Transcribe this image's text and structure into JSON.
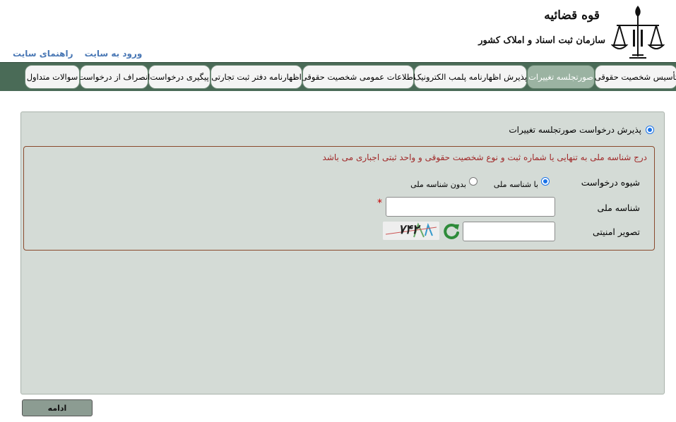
{
  "header": {
    "links": [
      "ورود به سایت",
      "راهنمای سایت"
    ],
    "logo_line1": "قوه قضائیه",
    "logo_line2": "سازمان ثبت اسناد و املاک کشور"
  },
  "nav": {
    "tabs": [
      {
        "label": "تأسیس شخصیت حقوقی",
        "active": false
      },
      {
        "label": "صورتجلسه تغییرات",
        "active": true
      },
      {
        "label": "پذیرش اظهارنامه پلمب الکترونیک",
        "active": false
      },
      {
        "label": "اطلاعات عمومی شخصیت حقوقی",
        "active": false
      },
      {
        "label": "اظهارنامه دفتر ثبت تجارتی",
        "active": false
      },
      {
        "label": "پیگیری درخواست",
        "active": false
      },
      {
        "label": "انصراف از درخواست",
        "active": false
      },
      {
        "label": "سوالات متداول",
        "active": false
      }
    ]
  },
  "form": {
    "main_option": "پذیرش درخواست صورتجلسه تغییرات",
    "notice": "درج شناسه ملی به تنهایی یا شماره ثبت و نوع شخصیت حقوقی و واحد ثبتی اجباری می باشد",
    "method_label": "شیوه درخواست",
    "method_options": [
      "با شناسه ملی",
      "بدون شناسه ملی"
    ],
    "method_selected": "با شناسه ملی",
    "national_id_label": "شناسه ملی",
    "national_id_value": "",
    "required_mark": "*",
    "captcha_label": "تصویر امنیتی",
    "captcha_value": "",
    "captcha_text": "۷۴۲"
  },
  "continue_label": "ادامه"
}
